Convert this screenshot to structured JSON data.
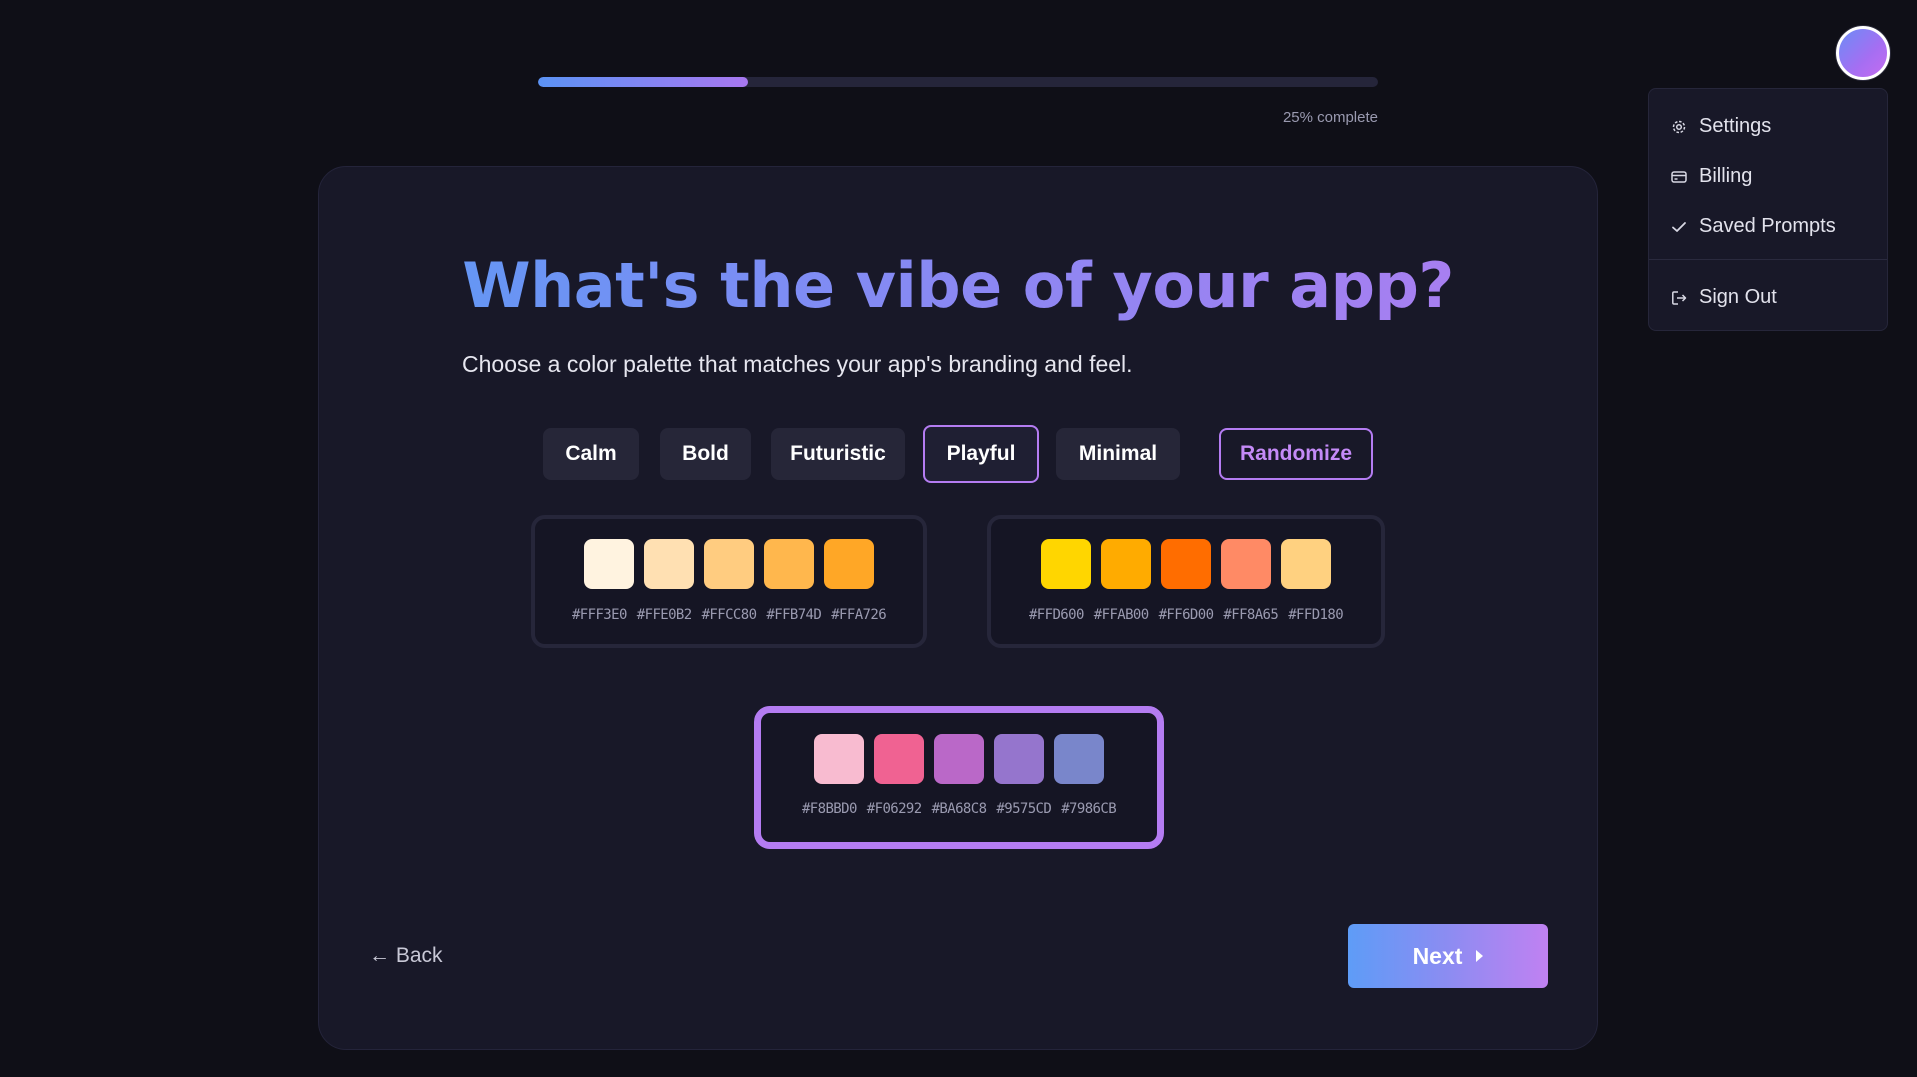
{
  "progress": {
    "percent": 25,
    "label": "25% complete"
  },
  "header": {
    "title": "What's the vibe of your app?",
    "subtitle": "Choose a color palette that matches your app's branding and feel."
  },
  "vibes": {
    "options": [
      "Calm",
      "Bold",
      "Futuristic",
      "Playful",
      "Minimal"
    ],
    "selected": "Playful",
    "randomize_label": "Randomize"
  },
  "palettes": [
    {
      "colors": [
        "#FFF3E0",
        "#FFE0B2",
        "#FFCC80",
        "#FFB74D",
        "#FFA726"
      ],
      "labels": [
        "#FFF3E0",
        "#FFE0B2",
        "#FFCC80",
        "#FFB74D",
        "#FFA726"
      ],
      "selected": false
    },
    {
      "colors": [
        "#FFD600",
        "#FFAB00",
        "#FF6D00",
        "#FF8A65",
        "#FFD180"
      ],
      "labels": [
        "#FFD600",
        "#FFAB00",
        "#FF6D00",
        "#FF8A65",
        "#FFD180"
      ],
      "selected": false
    },
    {
      "colors": [
        "#F8BBD0",
        "#F06292",
        "#BA68C8",
        "#9575CD",
        "#7986CB"
      ],
      "labels": [
        "#F8BBD0",
        "#F06292",
        "#BA68C8",
        "#9575CD",
        "#7986CB"
      ],
      "selected": true
    }
  ],
  "nav": {
    "back_label": "← Back",
    "next_label": "Next"
  },
  "user_menu": {
    "items": [
      {
        "label": "Settings",
        "icon": "gear-icon"
      },
      {
        "label": "Billing",
        "icon": "credit-card-icon"
      },
      {
        "label": "Saved Prompts",
        "icon": "check-icon"
      },
      {
        "label": "Sign Out",
        "icon": "sign-out-icon"
      }
    ]
  },
  "colors": {
    "accent": "#B47CF2",
    "gradient_start": "#5B9AF5",
    "gradient_end": "#C081F2",
    "background": "#0F0F17",
    "card": "#181828"
  }
}
